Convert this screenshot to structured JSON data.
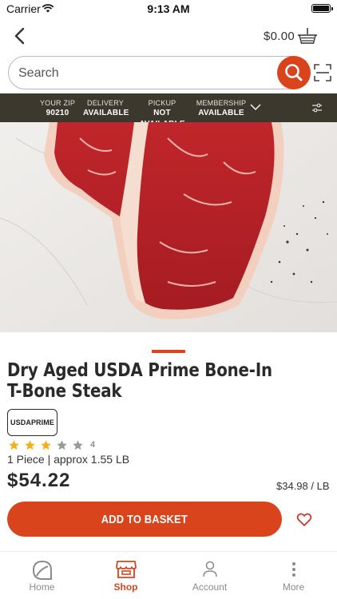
{
  "status_bar": {
    "carrier": "Carrier",
    "time": "9:13 AM"
  },
  "header": {
    "cart_total": "$0.00"
  },
  "search": {
    "placeholder": "Search"
  },
  "info_bar": {
    "zip": {
      "label": "YOUR ZIP",
      "value": "90210"
    },
    "delivery": {
      "label": "DELIVERY",
      "value": "AVAILABLE"
    },
    "pickup": {
      "label": "PICKUP",
      "value": "NOT AVAILABLE"
    },
    "membership": {
      "label": "MEMBERSHIP",
      "value": "AVAILABLE"
    }
  },
  "product": {
    "title": "Dry Aged USDA Prime Bone-In T-Bone Steak",
    "badge": "USDAPRIME",
    "rating": {
      "stars": 3,
      "max": 5,
      "count": "4"
    },
    "size": "1 Piece | approx 1.55 LB",
    "price": "$54.22",
    "unit_price": "$34.98 / LB"
  },
  "actions": {
    "add_to_basket": "ADD TO BASKET"
  },
  "tabs": [
    {
      "label": "Home",
      "icon": "home-icon"
    },
    {
      "label": "Shop",
      "icon": "shop-icon"
    },
    {
      "label": "Account",
      "icon": "account-icon"
    },
    {
      "label": "More",
      "icon": "more-icon"
    }
  ],
  "colors": {
    "accent": "#d9441d",
    "info_bar_bg": "#3b382e",
    "star_filled": "#f2b01e",
    "star_empty": "#9a9a9a"
  }
}
